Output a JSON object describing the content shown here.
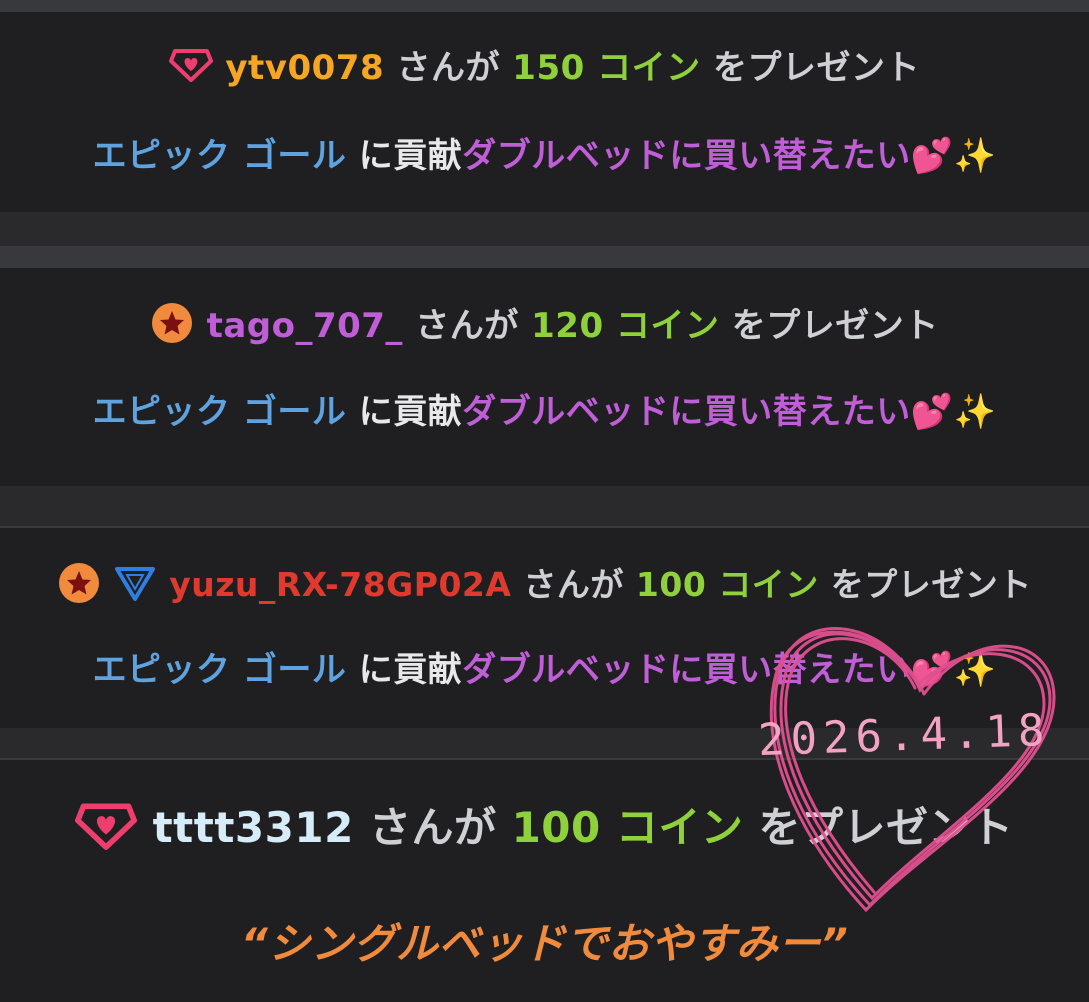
{
  "colors": {
    "band_bg": "#1f1f21",
    "gap_bg": "#38393d",
    "coin_green": "#8fd13a",
    "goal_blue": "#5ea3e0",
    "message_purple": "#c05ed8",
    "quote_orange": "#f08a3c",
    "heart_pink": "#e0508f"
  },
  "gifts": [
    {
      "username": "ytv0078",
      "username_color": "#f5a623",
      "badges": [
        "pink-gem-icon"
      ],
      "mid_text": "さんが",
      "coin_text": "150 コイン",
      "tail_text": "をプレゼント",
      "goal_name": "エピック ゴール",
      "contrib_text": "に貢献",
      "goal_message": "ダブルベッドに買い替えたい",
      "emoji": "💕✨"
    },
    {
      "username": "tago_707_",
      "username_color": "#c05ed8",
      "badges": [
        "orange-star-icon"
      ],
      "mid_text": "さんが",
      "coin_text": "120 コイン",
      "tail_text": "をプレゼント",
      "goal_name": "エピック ゴール",
      "contrib_text": "に貢献",
      "goal_message": "ダブルベッドに買い替えたい",
      "emoji": "💕✨"
    },
    {
      "username": "yuzu_RX-78GP02A",
      "username_color": "#e03a2f",
      "badges": [
        "orange-star-icon",
        "blue-triangle-icon"
      ],
      "mid_text": "さんが",
      "coin_text": "100 コイン",
      "tail_text": "をプレゼント",
      "goal_name": "エピック ゴール",
      "contrib_text": "に貢献",
      "goal_message": "ダブルベッドに買い替えたい",
      "emoji": "💕✨"
    },
    {
      "username": "tttt3312",
      "username_color": "#d6ecf8",
      "badges": [
        "pink-gem-icon"
      ],
      "mid_text": "さんが",
      "coin_text": "100 コイン",
      "tail_text": "をプレゼント",
      "quote": "“シングルベッドでおやすみー”"
    }
  ],
  "overlay": {
    "date_text": "2026.4.18",
    "heart": "pink-scribble-heart-icon"
  }
}
